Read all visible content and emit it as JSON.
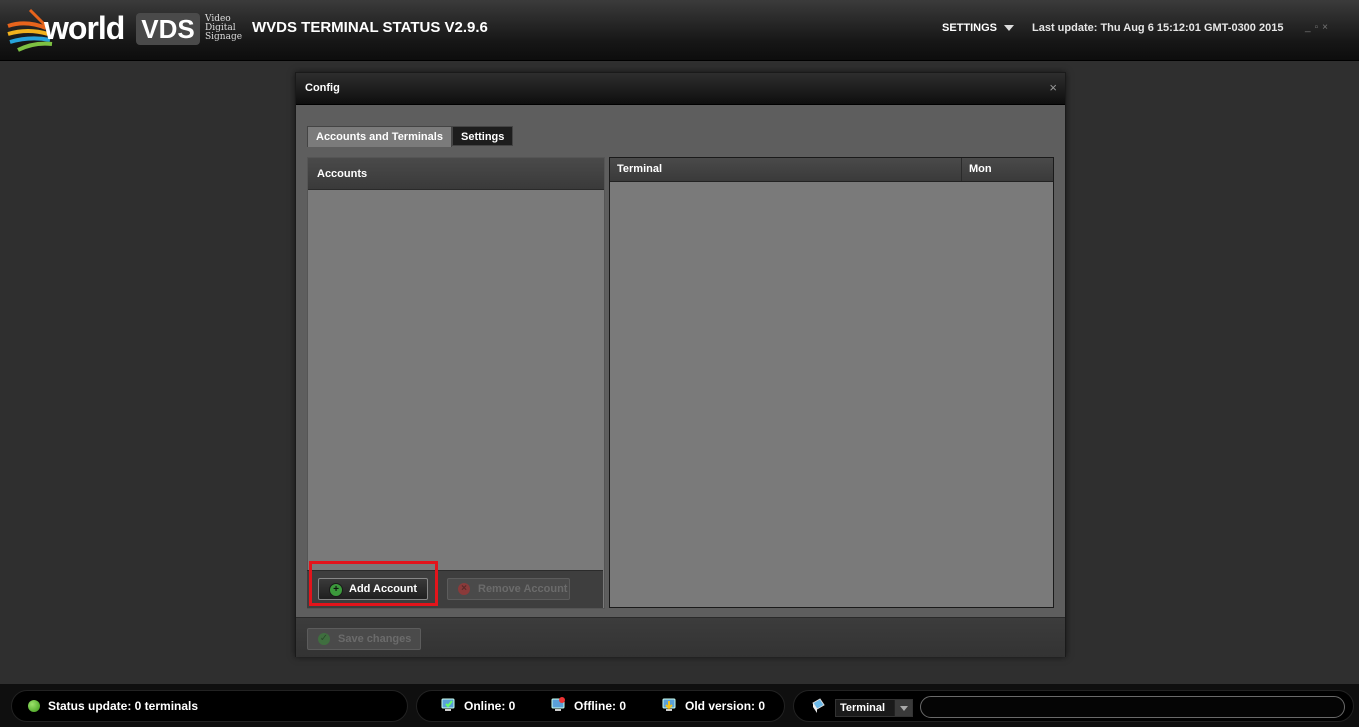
{
  "header": {
    "logo_world": "world",
    "logo_vds": "VDS",
    "logo_tagline": [
      "Video",
      "Digital",
      "Signage"
    ],
    "app_title": "WVDS TERMINAL STATUS V2.9.6",
    "settings_label": "SETTINGS",
    "last_update": "Last update: Thu Aug 6 15:12:01 GMT-0300 2015",
    "window_controls": [
      "_",
      "▫",
      "×"
    ]
  },
  "dialog": {
    "title": "Config",
    "close_symbol": "×",
    "tabs": [
      {
        "label": "Accounts and Terminals",
        "active": true
      },
      {
        "label": "Settings",
        "active": false
      }
    ],
    "accounts": {
      "header": "Accounts",
      "items": [],
      "add_button": "Add Account",
      "remove_button": "Remove Account"
    },
    "terminals": {
      "columns": [
        "Terminal",
        "Mon"
      ],
      "rows": []
    },
    "save_button": "Save changes"
  },
  "statusbar": {
    "status_text": "Status update: 0 terminals",
    "online": "Online: 0",
    "offline": "Offline: 0",
    "old_version": "Old version: 0",
    "filter_selected": "Terminal",
    "search_value": ""
  },
  "colors": {
    "highlight_box": "#e3141b",
    "status_dot": "#3c9a18"
  }
}
